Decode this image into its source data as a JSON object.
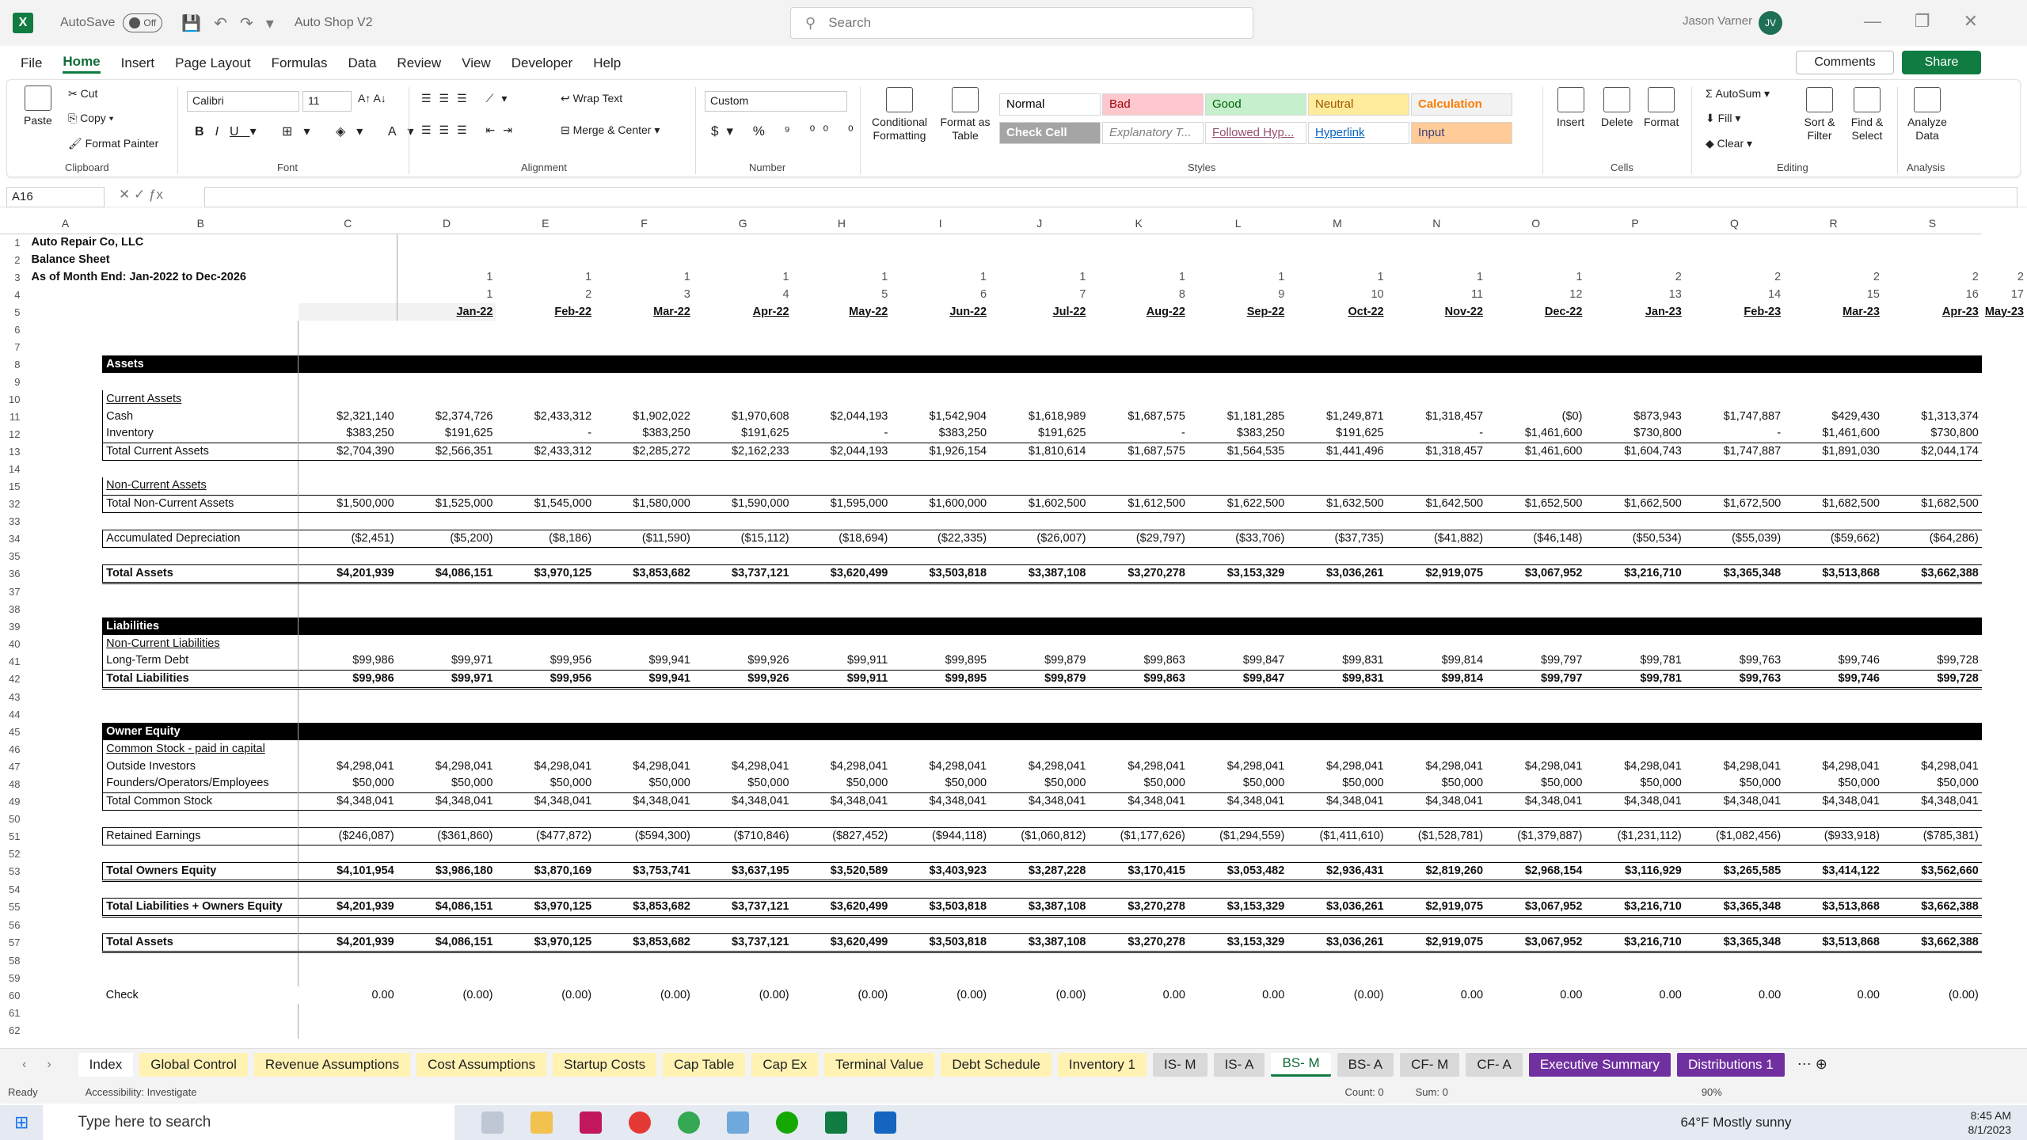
{
  "titlebar": {
    "autosave": "AutoSave",
    "autosave_state": "Off",
    "doc_name": "Auto Shop V2",
    "search_placeholder": "Search",
    "user": "Jason Varner",
    "initials": "JV"
  },
  "menu": [
    "File",
    "Home",
    "Insert",
    "Page Layout",
    "Formulas",
    "Data",
    "Review",
    "View",
    "Developer",
    "Help"
  ],
  "menu_active": "Home",
  "comments": "Comments",
  "share": "Share",
  "ribbon": {
    "paste": "Paste",
    "cut": "Cut",
    "copy": "Copy",
    "format_painter": "Format Painter",
    "clipboard": "Clipboard",
    "font_name": "Calibri",
    "font_size": "11",
    "font": "Font",
    "wrap": "Wrap Text",
    "merge": "Merge & Center",
    "alignment": "Alignment",
    "number_format": "Custom",
    "number": "Number",
    "cond_fmt": "Conditional Formatting",
    "fmt_table": "Format as Table",
    "styles": [
      {
        "t": "Normal",
        "bg": "#ffffff",
        "c": "#000000"
      },
      {
        "t": "Bad",
        "bg": "#ffc7ce",
        "c": "#9c0006"
      },
      {
        "t": "Good",
        "bg": "#c6efce",
        "c": "#006100"
      },
      {
        "t": "Neutral",
        "bg": "#ffeb9c",
        "c": "#9c5700"
      },
      {
        "t": "Calculation",
        "bg": "#f2f2f2",
        "c": "#fa7d00"
      },
      {
        "t": "Check Cell",
        "bg": "#a5a5a5",
        "c": "#ffffff"
      },
      {
        "t": "Explanatory T...",
        "bg": "#ffffff",
        "c": "#7f7f7f"
      },
      {
        "t": "Followed Hyp...",
        "bg": "#ffffff",
        "c": "#954f72"
      },
      {
        "t": "Hyperlink",
        "bg": "#ffffff",
        "c": "#0563c1"
      },
      {
        "t": "Input",
        "bg": "#ffcc99",
        "c": "#3f3f76"
      }
    ],
    "styles_label": "Styles",
    "insert": "Insert",
    "delete": "Delete",
    "format": "Format",
    "cells": "Cells",
    "autosum": "AutoSum",
    "fill": "Fill",
    "clear": "Clear",
    "sort": "Sort & Filter",
    "find": "Find & Select",
    "editing": "Editing",
    "analyze": "Analyze Data",
    "analysis": "Analysis"
  },
  "namebox": "A16",
  "columns": [
    "A",
    "B",
    "C",
    "D",
    "E",
    "F",
    "G",
    "H",
    "I",
    "J",
    "K",
    "L",
    "M",
    "N",
    "O",
    "P",
    "Q",
    "R",
    "S"
  ],
  "periods": {
    "r3": [
      "1",
      "1",
      "1",
      "1",
      "1",
      "1",
      "1",
      "1",
      "1",
      "1",
      "1",
      "1",
      "2",
      "2",
      "2",
      "2",
      "2"
    ],
    "r4": [
      "1",
      "2",
      "3",
      "4",
      "5",
      "6",
      "7",
      "8",
      "9",
      "10",
      "11",
      "12",
      "13",
      "14",
      "15",
      "16",
      "17"
    ],
    "r5": [
      "Jan-22",
      "Feb-22",
      "Mar-22",
      "Apr-22",
      "May-22",
      "Jun-22",
      "Jul-22",
      "Aug-22",
      "Sep-22",
      "Oct-22",
      "Nov-22",
      "Dec-22",
      "Jan-23",
      "Feb-23",
      "Mar-23",
      "Apr-23",
      "May-23"
    ]
  },
  "header": {
    "company": "Auto Repair Co, LLC",
    "sheet": "Balance Sheet",
    "asof": "As of Month End: Jan-2022 to Dec-2026"
  },
  "rows": [
    {
      "n": "6",
      "type": "blank"
    },
    {
      "n": "7",
      "type": "blank"
    },
    {
      "n": "8",
      "type": "black",
      "label": "Assets"
    },
    {
      "n": "9",
      "type": "blank"
    },
    {
      "n": "10",
      "type": "ulabel",
      "label": "Current Assets"
    },
    {
      "n": "11",
      "type": "data",
      "label": "Cash",
      "v": [
        "$2,321,140",
        "$2,374,726",
        "$2,433,312",
        "$1,902,022",
        "$1,970,608",
        "$2,044,193",
        "$1,542,904",
        "$1,618,989",
        "$1,687,575",
        "$1,181,285",
        "$1,249,871",
        "$1,318,457",
        "($0)",
        "$873,943",
        "$1,747,887",
        "$429,430",
        "$1,313,374"
      ]
    },
    {
      "n": "12",
      "type": "data",
      "label": "Inventory",
      "v": [
        "$383,250",
        "$191,625",
        "-",
        "$383,250",
        "$191,625",
        "-",
        "$383,250",
        "$191,625",
        "-",
        "$383,250",
        "$191,625",
        "-",
        "$1,461,600",
        "$730,800",
        "-",
        "$1,461,600",
        "$730,800"
      ]
    },
    {
      "n": "13",
      "type": "total",
      "label": "Total Current Assets",
      "v": [
        "$2,704,390",
        "$2,566,351",
        "$2,433,312",
        "$2,285,272",
        "$2,162,233",
        "$2,044,193",
        "$1,926,154",
        "$1,810,614",
        "$1,687,575",
        "$1,564,535",
        "$1,441,496",
        "$1,318,457",
        "$1,461,600",
        "$1,604,743",
        "$1,747,887",
        "$1,891,030",
        "$2,044,174"
      ]
    },
    {
      "n": "14",
      "type": "blank"
    },
    {
      "n": "15",
      "type": "label",
      "label": "Non-Current Assets"
    },
    {
      "n": "32",
      "type": "total",
      "label": "Total Non-Current Assets",
      "v": [
        "$1,500,000",
        "$1,525,000",
        "$1,545,000",
        "$1,580,000",
        "$1,590,000",
        "$1,595,000",
        "$1,600,000",
        "$1,602,500",
        "$1,612,500",
        "$1,622,500",
        "$1,632,500",
        "$1,642,500",
        "$1,652,500",
        "$1,662,500",
        "$1,672,500",
        "$1,682,500",
        "$1,682,500"
      ]
    },
    {
      "n": "33",
      "type": "blank"
    },
    {
      "n": "34",
      "type": "total",
      "label": "Accumulated Depreciation",
      "v": [
        "($2,451)",
        "($5,200)",
        "($8,186)",
        "($11,590)",
        "($15,112)",
        "($18,694)",
        "($22,335)",
        "($26,007)",
        "($29,797)",
        "($33,706)",
        "($37,735)",
        "($41,882)",
        "($46,148)",
        "($50,534)",
        "($55,039)",
        "($59,662)",
        "($64,286)"
      ]
    },
    {
      "n": "35",
      "type": "blank"
    },
    {
      "n": "36",
      "type": "btotal",
      "label": "Total Assets",
      "v": [
        "$4,201,939",
        "$4,086,151",
        "$3,970,125",
        "$3,853,682",
        "$3,737,121",
        "$3,620,499",
        "$3,503,818",
        "$3,387,108",
        "$3,270,278",
        "$3,153,329",
        "$3,036,261",
        "$2,919,075",
        "$3,067,952",
        "$3,216,710",
        "$3,365,348",
        "$3,513,868",
        "$3,662,388"
      ]
    },
    {
      "n": "37",
      "type": "blank"
    },
    {
      "n": "38",
      "type": "blank"
    },
    {
      "n": "39",
      "type": "black",
      "label": "Liabilities"
    },
    {
      "n": "40",
      "type": "ulabel",
      "label": "Non-Current Liabilities"
    },
    {
      "n": "41",
      "type": "data",
      "label": "Long-Term Debt",
      "v": [
        "$99,986",
        "$99,971",
        "$99,956",
        "$99,941",
        "$99,926",
        "$99,911",
        "$99,895",
        "$99,879",
        "$99,863",
        "$99,847",
        "$99,831",
        "$99,814",
        "$99,797",
        "$99,781",
        "$99,763",
        "$99,746",
        "$99,728"
      ]
    },
    {
      "n": "42",
      "type": "btotal",
      "label": "Total Liabilities",
      "v": [
        "$99,986",
        "$99,971",
        "$99,956",
        "$99,941",
        "$99,926",
        "$99,911",
        "$99,895",
        "$99,879",
        "$99,863",
        "$99,847",
        "$99,831",
        "$99,814",
        "$99,797",
        "$99,781",
        "$99,763",
        "$99,746",
        "$99,728"
      ]
    },
    {
      "n": "43",
      "type": "blank"
    },
    {
      "n": "44",
      "type": "blank"
    },
    {
      "n": "45",
      "type": "black",
      "label": "Owner Equity"
    },
    {
      "n": "46",
      "type": "ulabel",
      "label": "Common Stock - paid in capital"
    },
    {
      "n": "47",
      "type": "data",
      "label": "Outside Investors",
      "v": [
        "$4,298,041",
        "$4,298,041",
        "$4,298,041",
        "$4,298,041",
        "$4,298,041",
        "$4,298,041",
        "$4,298,041",
        "$4,298,041",
        "$4,298,041",
        "$4,298,041",
        "$4,298,041",
        "$4,298,041",
        "$4,298,041",
        "$4,298,041",
        "$4,298,041",
        "$4,298,041",
        "$4,298,041"
      ]
    },
    {
      "n": "48",
      "type": "data",
      "label": "Founders/Operators/Employees",
      "v": [
        "$50,000",
        "$50,000",
        "$50,000",
        "$50,000",
        "$50,000",
        "$50,000",
        "$50,000",
        "$50,000",
        "$50,000",
        "$50,000",
        "$50,000",
        "$50,000",
        "$50,000",
        "$50,000",
        "$50,000",
        "$50,000",
        "$50,000"
      ]
    },
    {
      "n": "49",
      "type": "total",
      "label": "Total Common Stock",
      "v": [
        "$4,348,041",
        "$4,348,041",
        "$4,348,041",
        "$4,348,041",
        "$4,348,041",
        "$4,348,041",
        "$4,348,041",
        "$4,348,041",
        "$4,348,041",
        "$4,348,041",
        "$4,348,041",
        "$4,348,041",
        "$4,348,041",
        "$4,348,041",
        "$4,348,041",
        "$4,348,041",
        "$4,348,041"
      ]
    },
    {
      "n": "50",
      "type": "blank"
    },
    {
      "n": "51",
      "type": "total",
      "label": "Retained Earnings",
      "v": [
        "($246,087)",
        "($361,860)",
        "($477,872)",
        "($594,300)",
        "($710,846)",
        "($827,452)",
        "($944,118)",
        "($1,060,812)",
        "($1,177,626)",
        "($1,294,559)",
        "($1,411,610)",
        "($1,528,781)",
        "($1,379,887)",
        "($1,231,112)",
        "($1,082,456)",
        "($933,918)",
        "($785,381)"
      ]
    },
    {
      "n": "52",
      "type": "blank"
    },
    {
      "n": "53",
      "type": "btotal",
      "label": "Total Owners Equity",
      "v": [
        "$4,101,954",
        "$3,986,180",
        "$3,870,169",
        "$3,753,741",
        "$3,637,195",
        "$3,520,589",
        "$3,403,923",
        "$3,287,228",
        "$3,170,415",
        "$3,053,482",
        "$2,936,431",
        "$2,819,260",
        "$2,968,154",
        "$3,116,929",
        "$3,265,585",
        "$3,414,122",
        "$3,562,660"
      ]
    },
    {
      "n": "54",
      "type": "blank"
    },
    {
      "n": "55",
      "type": "btotal",
      "label": "Total Liabilities + Owners Equity",
      "v": [
        "$4,201,939",
        "$4,086,151",
        "$3,970,125",
        "$3,853,682",
        "$3,737,121",
        "$3,620,499",
        "$3,503,818",
        "$3,387,108",
        "$3,270,278",
        "$3,153,329",
        "$3,036,261",
        "$2,919,075",
        "$3,067,952",
        "$3,216,710",
        "$3,365,348",
        "$3,513,868",
        "$3,662,388"
      ]
    },
    {
      "n": "56",
      "type": "blank"
    },
    {
      "n": "57",
      "type": "btotal",
      "label": "Total Assets",
      "v": [
        "$4,201,939",
        "$4,086,151",
        "$3,970,125",
        "$3,853,682",
        "$3,737,121",
        "$3,620,499",
        "$3,503,818",
        "$3,387,108",
        "$3,270,278",
        "$3,153,329",
        "$3,036,261",
        "$2,919,075",
        "$3,067,952",
        "$3,216,710",
        "$3,365,348",
        "$3,513,868",
        "$3,662,388"
      ]
    },
    {
      "n": "58",
      "type": "blank"
    },
    {
      "n": "59",
      "type": "blank"
    },
    {
      "n": "60",
      "type": "check",
      "label": "Check",
      "v": [
        "0.00",
        "(0.00)",
        "(0.00)",
        "(0.00)",
        "(0.00)",
        "(0.00)",
        "(0.00)",
        "(0.00)",
        "0.00",
        "0.00",
        "(0.00)",
        "0.00",
        "0.00",
        "0.00",
        "0.00",
        "0.00",
        "(0.00)"
      ]
    },
    {
      "n": "61",
      "type": "blank"
    },
    {
      "n": "62",
      "type": "blank"
    }
  ],
  "tabs": [
    {
      "t": "Index",
      "k": "w"
    },
    {
      "t": "Global Control",
      "k": "y"
    },
    {
      "t": "Revenue Assumptions",
      "k": "y"
    },
    {
      "t": "Cost Assumptions",
      "k": "y"
    },
    {
      "t": "Startup Costs",
      "k": "y"
    },
    {
      "t": "Cap Table",
      "k": "y"
    },
    {
      "t": "Cap Ex",
      "k": "y"
    },
    {
      "t": "Terminal Value",
      "k": "y"
    },
    {
      "t": "Debt Schedule",
      "k": "y"
    },
    {
      "t": "Inventory 1",
      "k": "y"
    },
    {
      "t": "IS- M",
      "k": "g"
    },
    {
      "t": "IS- A",
      "k": "g"
    },
    {
      "t": "BS- M",
      "k": "active"
    },
    {
      "t": "BS- A",
      "k": "g"
    },
    {
      "t": "CF- M",
      "k": "g"
    },
    {
      "t": "CF- A",
      "k": "g"
    },
    {
      "t": "Executive Summary",
      "k": "p"
    },
    {
      "t": "Distributions 1",
      "k": "p"
    }
  ],
  "status": {
    "ready": "Ready",
    "accessibility": "Accessibility: Investigate",
    "count": "Count: 0",
    "sum": "Sum: 0",
    "zoom": "90%"
  },
  "taskbar": {
    "search": "Type here to search",
    "weather": "64°F  Mostly sunny",
    "time": "8:45 AM",
    "date": "8/1/2023"
  }
}
